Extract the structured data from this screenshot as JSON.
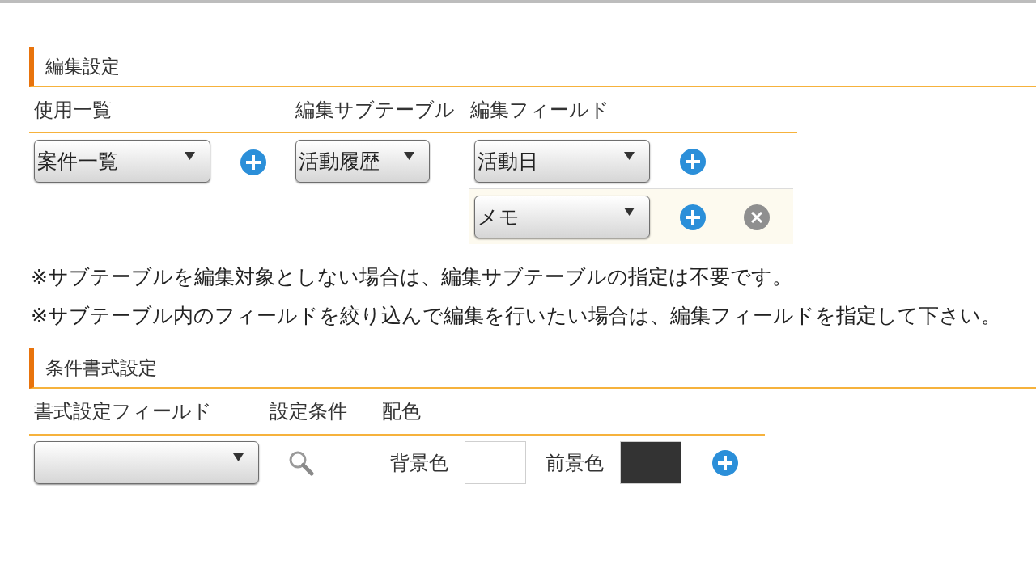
{
  "edit_settings": {
    "title": "編集設定",
    "columns": [
      "使用一覧",
      "編集サブテーブル",
      "編集フィールド"
    ],
    "list": {
      "value": "案件一覧"
    },
    "subtable": {
      "value": "活動履歴"
    },
    "fields": [
      {
        "value": "活動日",
        "highlighted": false,
        "removable": false
      },
      {
        "value": "メモ",
        "highlighted": true,
        "removable": true
      }
    ],
    "notes": [
      "※サブテーブルを編集対象としない場合は、編集サブテーブルの指定は不要です。",
      "※サブテーブル内のフィールドを絞り込んで編集を行いたい場合は、編集フィールドを指定して下さい。"
    ]
  },
  "conditional_format": {
    "title": "条件書式設定",
    "columns": [
      "書式設定フィールド",
      "設定条件",
      "配色"
    ],
    "colors": [
      {
        "label": "背景色",
        "color": "#ffffff"
      },
      {
        "label": "前景色",
        "color": "#333333"
      }
    ]
  }
}
